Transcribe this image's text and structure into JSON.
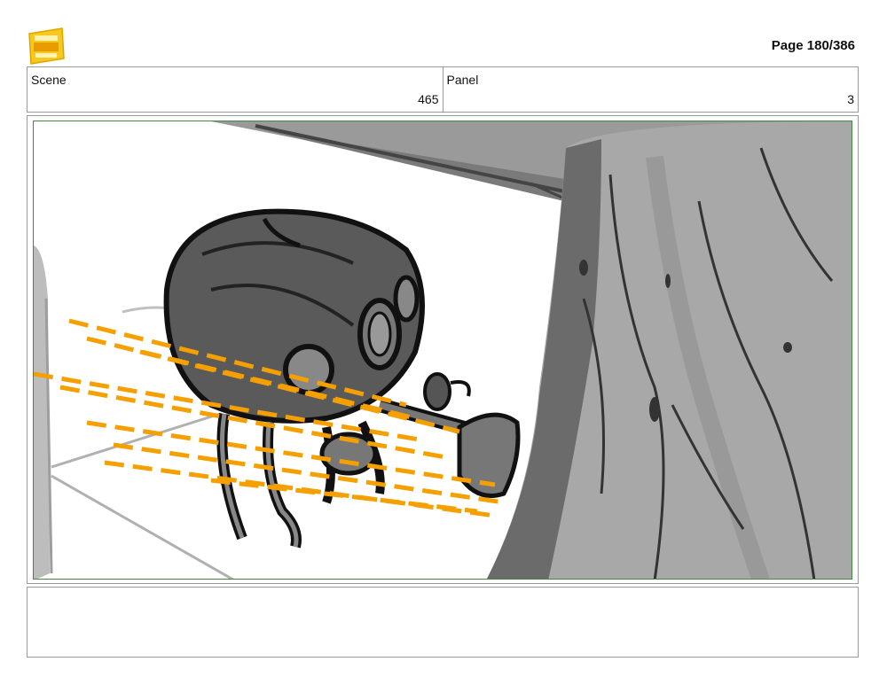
{
  "header": {
    "logo_icon": "jedi-logo-icon",
    "page_label": "Page 180/386"
  },
  "info": {
    "scene_label": "Scene",
    "scene_value": "465",
    "panel_label": "Panel",
    "panel_value": "3"
  },
  "panel": {
    "frame_color": "#3f8a3f",
    "laser_color": "#f5a000"
  },
  "notes": {
    "text": ""
  }
}
